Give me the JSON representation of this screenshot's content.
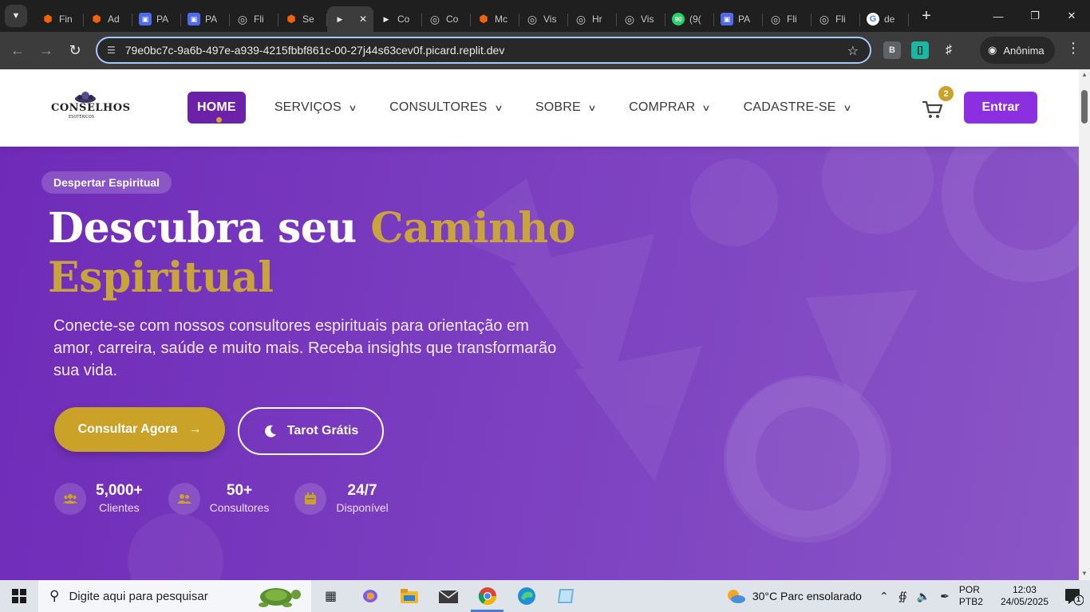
{
  "browser": {
    "tabs": [
      {
        "icon": "replit-icon",
        "label": "Fin",
        "color": "#f26207"
      },
      {
        "icon": "replit-icon",
        "label": "Ad",
        "color": "#f26207"
      },
      {
        "icon": "app-icon",
        "label": "PA",
        "color": "#4f6bed"
      },
      {
        "icon": "app-icon",
        "label": "PA",
        "color": "#4f6bed"
      },
      {
        "icon": "globe-icon",
        "label": "Fli",
        "color": "#8a8a8a"
      },
      {
        "icon": "replit-icon",
        "label": "Se",
        "color": "#f26207"
      },
      {
        "icon": "site-icon",
        "label": "",
        "color": "#ffffff",
        "active": true
      },
      {
        "icon": "site-icon",
        "label": "Co",
        "color": "#ffffff"
      },
      {
        "icon": "globe-icon",
        "label": "Co",
        "color": "#8a8a8a"
      },
      {
        "icon": "replit-icon",
        "label": "Mc",
        "color": "#f26207"
      },
      {
        "icon": "globe-icon",
        "label": "Vis",
        "color": "#8a8a8a"
      },
      {
        "icon": "globe-icon",
        "label": "Hr",
        "color": "#8a8a8a"
      },
      {
        "icon": "globe-icon",
        "label": "Vis",
        "color": "#8a8a8a"
      },
      {
        "icon": "whatsapp-icon",
        "label": "(9(",
        "color": "#25d366",
        "badge": "90"
      },
      {
        "icon": "app-icon",
        "label": "PA",
        "color": "#4f6bed"
      },
      {
        "icon": "globe-icon",
        "label": "Fli",
        "color": "#8a8a8a"
      },
      {
        "icon": "globe-icon",
        "label": "Fli",
        "color": "#8a8a8a"
      },
      {
        "icon": "google-icon",
        "label": "de",
        "color": "#ffffff"
      }
    ],
    "url": "79e0bc7c-9a6b-497e-a939-4215fbbf861c-00-27j44s63cev0f.picard.replit.dev",
    "profile_label": "Anônima",
    "extension_b": "B"
  },
  "site": {
    "logo_text": "CONSELHOS",
    "logo_sub": "ESOTÉRICOS",
    "nav": [
      {
        "label": "HOME",
        "active": true
      },
      {
        "label": "SERVIÇOS"
      },
      {
        "label": "CONSULTORES"
      },
      {
        "label": "SOBRE"
      },
      {
        "label": "COMPRAR"
      },
      {
        "label": "CADASTRE-SE"
      }
    ],
    "cart_count": "2",
    "login_label": "Entrar"
  },
  "hero": {
    "badge": "Despertar Espiritual",
    "title_white": "Descubra seu ",
    "title_gold_1": "Caminho",
    "title_gold_2": "Espiritual",
    "subtitle": "Conecte-se com nossos consultores espirituais para orientação em amor, carreira, saúde e muito mais. Receba insights que transformarão sua vida.",
    "primary_button": "Consultar Agora",
    "secondary_button": "Tarot Grátis",
    "stats": [
      {
        "value": "5,000+",
        "label": "Clientes",
        "icon": "users-icon"
      },
      {
        "value": "50+",
        "label": "Consultores",
        "icon": "group-icon"
      },
      {
        "value": "24/7",
        "label": "Disponível",
        "icon": "calendar-icon"
      }
    ],
    "colors": {
      "purple": "#6f2bb8",
      "gold": "#c9a227",
      "login": "#8b2fe0"
    }
  },
  "taskbar": {
    "search_placeholder": "Digite aqui para pesquisar",
    "weather": "30°C  Parc ensolarado",
    "lang_1": "POR",
    "lang_2": "PTB2",
    "time": "12:03",
    "date": "24/05/2025",
    "notification_count": "1"
  }
}
